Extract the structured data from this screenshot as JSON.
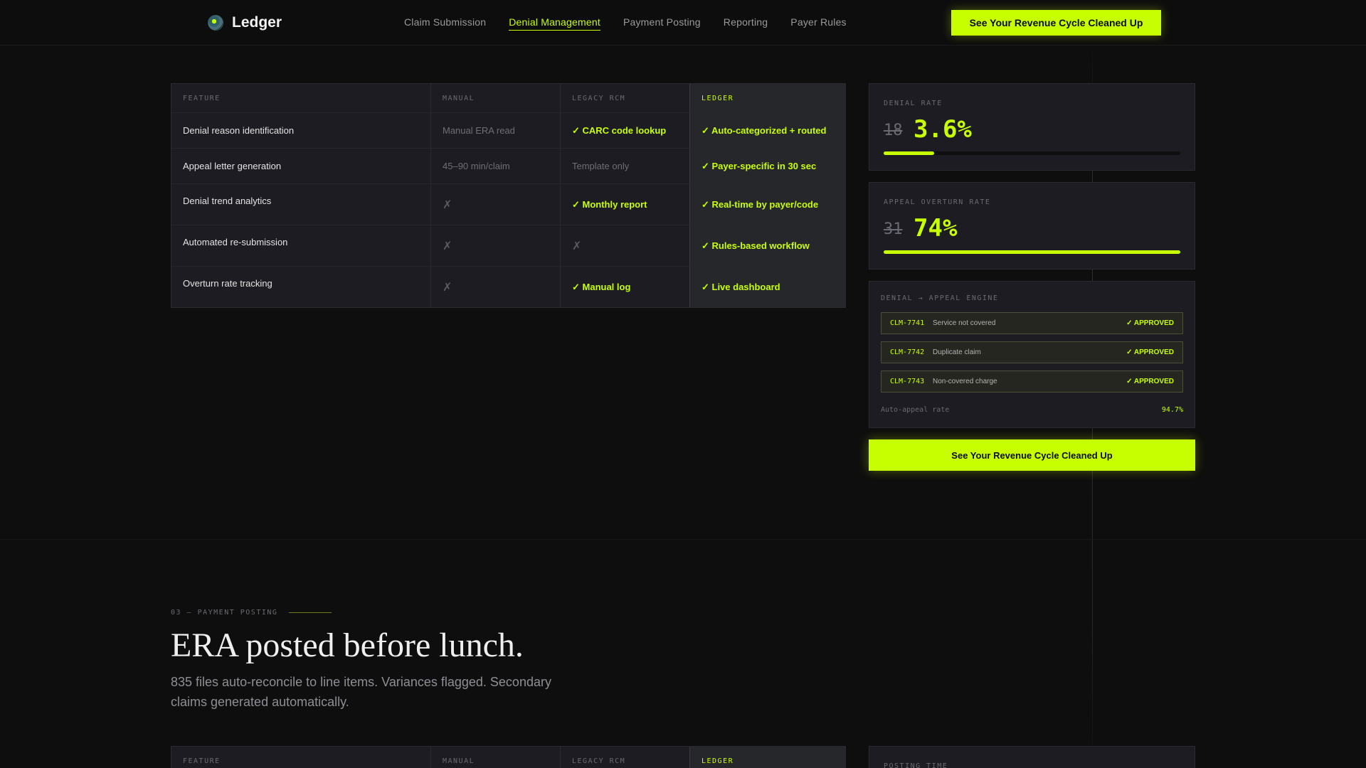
{
  "header": {
    "brand": "Ledger",
    "nav": [
      "Claim Submission",
      "Denial Management",
      "Payment Posting",
      "Reporting",
      "Payer Rules"
    ],
    "active_nav": "Denial Management",
    "cta": "See Your Revenue Cycle Cleaned Up"
  },
  "table": {
    "headers": [
      "FEATURE",
      "MANUAL",
      "LEGACY RCM",
      "LEDGER"
    ],
    "rows": [
      {
        "feature": "Denial reason identification",
        "manual": "Manual ERA read",
        "legacy": "✓ CARC code lookup",
        "ledger": "✓ Auto-categorized + routed"
      },
      {
        "feature": "Appeal letter generation",
        "manual": "45–90 min/claim",
        "legacy": "Template only",
        "ledger": "✓ Payer-specific in 30 sec"
      },
      {
        "feature": "Denial trend analytics",
        "manual": "✗",
        "legacy": "✓ Monthly report",
        "ledger": "✓ Real-time by payer/code"
      },
      {
        "feature": "Automated re-submission",
        "manual": "✗",
        "legacy": "✗",
        "ledger": "✓ Rules-based workflow"
      },
      {
        "feature": "Overturn rate tracking",
        "manual": "✗",
        "legacy": "✓ Manual log",
        "ledger": "✓ Live dashboard"
      }
    ]
  },
  "stats": {
    "denial": {
      "label": "DENIAL RATE",
      "old": "18",
      "new": "3.6%",
      "progress": 0.17
    },
    "overturn": {
      "label": "APPEAL OVERTURN RATE",
      "old": "31",
      "new": "74%",
      "progress": 1.0
    }
  },
  "engine": {
    "label": "DENIAL → APPEAL ENGINE",
    "claims": [
      {
        "id": "CLM-7741",
        "reason": "Service not covered",
        "status": "✓ APPROVED"
      },
      {
        "id": "CLM-7742",
        "reason": "Duplicate claim",
        "status": "✓ APPROVED"
      },
      {
        "id": "CLM-7743",
        "reason": "Non-covered charge",
        "status": "✓ APPROVED"
      }
    ],
    "auto_label": "Auto-appeal rate",
    "auto_value": "94.7%"
  },
  "side_cta": "See Your Revenue Cycle Cleaned Up",
  "section3": {
    "eyebrow": "03 — PAYMENT POSTING",
    "heading": "ERA posted before lunch.",
    "sub": "835 files auto-reconcile to line items. Variances flagged. Secondary claims generated automatically.",
    "table_headers": [
      "FEATURE",
      "MANUAL",
      "LEGACY RCM",
      "LEDGER"
    ],
    "stat_label": "POSTING TIME"
  },
  "colors": {
    "accent": "#c8ff00",
    "background": "#0e0e0e",
    "panel": "#1c1c22"
  }
}
